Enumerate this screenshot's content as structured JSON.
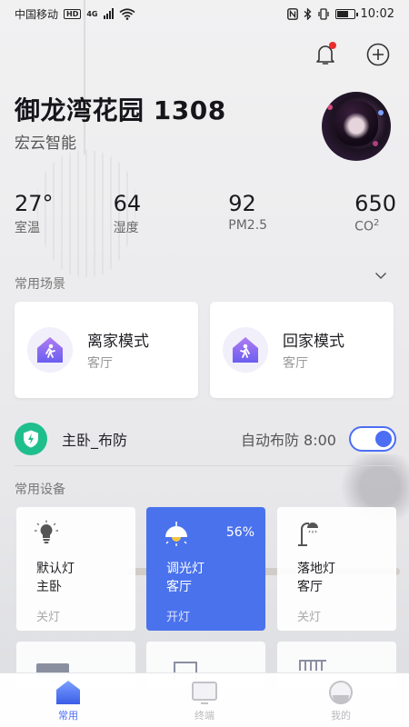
{
  "status_bar": {
    "carrier": "中国移动",
    "hd": "HD",
    "network": "4G",
    "time": "10:02"
  },
  "header": {
    "title": "御龙湾花园 1308",
    "subtitle": "宏云智能",
    "notification_icon": "bell-icon",
    "add_icon": "plus-circle-icon",
    "has_unread": true
  },
  "environment": [
    {
      "value": "27°",
      "label": "室温"
    },
    {
      "value": "64",
      "label": "湿度"
    },
    {
      "value": "92",
      "label": "PM2.5"
    },
    {
      "value": "650",
      "label": "CO",
      "label_sup": "2"
    }
  ],
  "scenes": {
    "section_label": "常用场景",
    "items": [
      {
        "name": "离家模式",
        "room": "客厅",
        "icon": "house-walk-out-icon"
      },
      {
        "name": "回家模式",
        "room": "客厅",
        "icon": "house-walk-in-icon"
      }
    ]
  },
  "security": {
    "name": "主卧_布防",
    "auto_label": "自动布防 8:00",
    "enabled": true,
    "icon": "shield-bolt-icon"
  },
  "devices": {
    "section_label": "常用设备",
    "items": [
      {
        "name": "默认灯",
        "room": "主卧",
        "state": "关灯",
        "on": false,
        "icon": "bulb-icon"
      },
      {
        "name": "调光灯",
        "room": "客厅",
        "state": "开灯",
        "on": true,
        "percent": "56%",
        "icon": "pendant-lamp-icon"
      },
      {
        "name": "落地灯",
        "room": "客厅",
        "state": "关灯",
        "on": false,
        "icon": "floor-lamp-icon"
      }
    ]
  },
  "bottom_nav": [
    {
      "label": "常用",
      "active": true,
      "icon": "home-icon"
    },
    {
      "label": "终端",
      "active": false,
      "icon": "monitor-icon"
    },
    {
      "label": "我的",
      "active": false,
      "icon": "profile-icon"
    }
  ],
  "colors": {
    "accent": "#4c6ef5",
    "active_card": "#4a72ec",
    "shield": "#1fbf8c",
    "notification_dot": "#ea2d2d"
  }
}
